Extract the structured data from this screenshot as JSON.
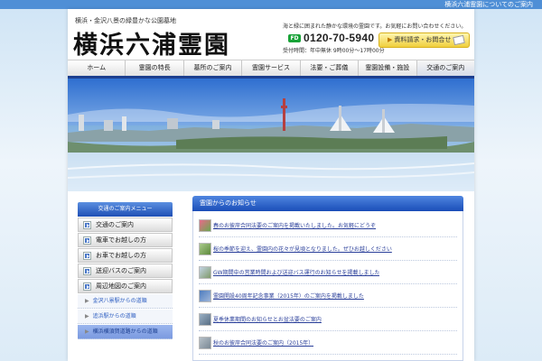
{
  "top_bar": {
    "link": "横浜六浦霊園についてのご案内"
  },
  "header": {
    "tagline": "横浜・金沢八景の緑豊かな公園墓地",
    "logo": "横浜六浦霊園",
    "description": "海と緑に囲まれた静かな環境の霊園です。お気軽にお問い合わせください。",
    "phone_badge": "FD",
    "phone": "0120-70-5940",
    "hours": "受付時間：年中無休 9時00分～17時00分",
    "request_button": "資料請求・お問合せ",
    "request_arrow": "▶"
  },
  "nav": {
    "items": [
      "ホーム",
      "霊園の特長",
      "墓所のご案内",
      "霊園サービス",
      "法要・ご葬儀",
      "霊園設備・施設",
      "交通のご案内"
    ],
    "active_index": 6
  },
  "sidebar": {
    "title": "交通のご案内メニュー",
    "items": [
      "交通のご案内",
      "電車でお越しの方",
      "お車でお越しの方",
      "送迎バスのご案内",
      "周辺地図のご案内"
    ],
    "sub_items": [
      "金沢八景駅からの道順",
      "追浜駅からの道順",
      "横浜横須賀道路からの道順"
    ],
    "sub_bullet": "▶",
    "active_sub_index": 2
  },
  "main": {
    "title": "霊園からのお知らせ",
    "news": [
      "春のお彼岸合同法要のご案内を掲載いたしました。お気軽にどうぞ",
      "桜の季節を迎え、霊園内の花々が見頃となりました。ぜひお越しください",
      "GW期間中の営業時間および送迎バス運行のお知らせを掲載しました",
      "霊園開設40周年記念事業（2015年）のご案内を掲載しました",
      "夏季休業期間のお知らせとお盆法要のご案内",
      "秋のお彼岸合同法要のご案内（2015年）"
    ]
  },
  "colors": {
    "accent_blue": "#1a4db8",
    "link_blue": "#2a3f9a",
    "phone_green": "#19a338",
    "button_yellow": "#f0cf3c"
  }
}
